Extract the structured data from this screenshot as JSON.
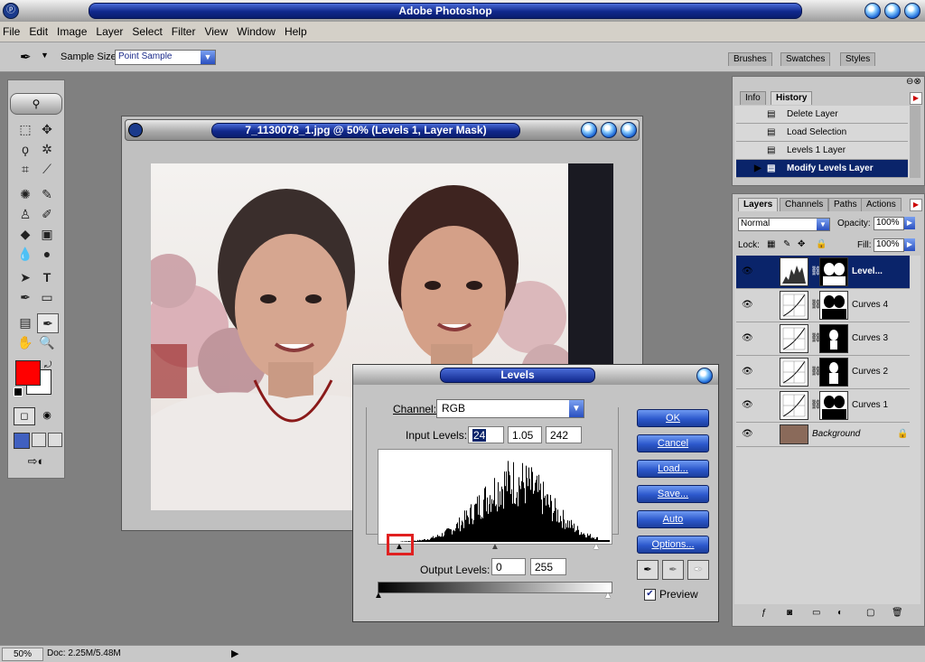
{
  "app": {
    "title": "Adobe Photoshop"
  },
  "menu": [
    "File",
    "Edit",
    "Image",
    "Layer",
    "Select",
    "Filter",
    "View",
    "Window",
    "Help"
  ],
  "options_bar": {
    "sample_size_label": "Sample Size:",
    "sample_size_value": "Point Sample",
    "palette_tabs": [
      "Brushes",
      "Swatches",
      "Styles"
    ]
  },
  "document": {
    "title": "7_1130078_1.jpg @ 50% (Levels 1, Layer Mask)"
  },
  "levels": {
    "title": "Levels",
    "channel_label": "Channel:",
    "channel_value": "RGB",
    "input_label": "Input Levels:",
    "input_values": [
      "24",
      "1.05",
      "242"
    ],
    "output_label": "Output Levels:",
    "output_values": [
      "0",
      "255"
    ],
    "buttons": [
      "OK",
      "Cancel",
      "Load...",
      "Save...",
      "Auto",
      "Options..."
    ],
    "preview_label": "Preview",
    "preview_checked": true
  },
  "history": {
    "tabs": [
      "Info",
      "History"
    ],
    "items": [
      "Delete Layer",
      "Load Selection",
      "Levels 1 Layer",
      "Modify Levels Layer"
    ]
  },
  "layers": {
    "tabs": [
      "Layers",
      "Channels",
      "Paths",
      "Actions"
    ],
    "blend_mode": "Normal",
    "opacity_label": "Opacity:",
    "opacity": "100%",
    "lock_label": "Lock:",
    "fill_label": "Fill:",
    "fill": "100%",
    "items": [
      "Level...",
      "Curves 4",
      "Curves 3",
      "Curves 2",
      "Curves 1",
      "Background"
    ]
  },
  "status": {
    "zoom": "50%",
    "doc": "Doc: 2.25M/5.48M"
  },
  "colors": {
    "foreground": "#ff0000",
    "background": "#ffffff",
    "highlight": "#0a246a"
  }
}
